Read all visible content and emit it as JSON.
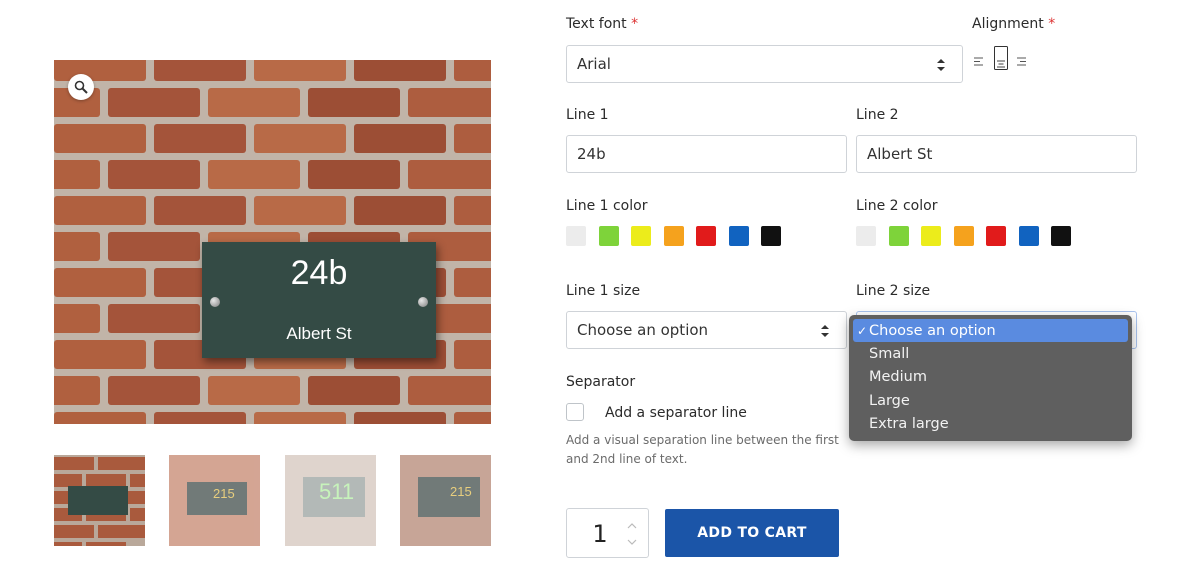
{
  "gallery": {
    "plaque_number": "24b",
    "plaque_street": "Albert St",
    "thumb2_text": "215",
    "thumb3_text": "511",
    "thumb4_text": "215"
  },
  "form": {
    "text_font": {
      "label": "Text font",
      "required_mark": "*",
      "value": "Arial"
    },
    "alignment": {
      "label": "Alignment",
      "required_mark": "*",
      "selected": "center"
    },
    "line1": {
      "label": "Line 1",
      "value": "24b"
    },
    "line2": {
      "label": "Line 2",
      "value": "Albert St"
    },
    "line1_color": {
      "label": "Line 1 color"
    },
    "line2_color": {
      "label": "Line 2 color"
    },
    "swatches": [
      "#ececec",
      "#7ed33a",
      "#ecec1b",
      "#f5a21d",
      "#e11b1b",
      "#1163c0",
      "#111111"
    ],
    "line1_size": {
      "label": "Line 1 size",
      "value": "Choose an option"
    },
    "line2_size": {
      "label": "Line 2 size",
      "value": "Choose an option",
      "options": [
        "Choose an option",
        "Small",
        "Medium",
        "Large",
        "Extra large"
      ],
      "selected_index": 0,
      "check_mark": "✓"
    },
    "separator": {
      "label": "Separator",
      "checkbox_label": "Add a separator line",
      "help": "Add a visual separation line between the first and 2nd line of text."
    },
    "quantity": "1",
    "add_to_cart": "ADD TO CART"
  }
}
